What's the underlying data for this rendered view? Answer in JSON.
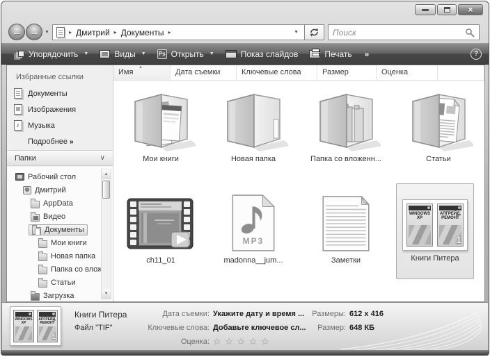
{
  "glyphs": {
    "back": "←",
    "forward": "→",
    "dropdown": "▼",
    "nav_history": "▼",
    "breadcrumb_sep": "▸",
    "overflow": "»",
    "help": "?",
    "close": "×",
    "sort_asc": "▲",
    "panel_collapse": "∨",
    "scroll_up": "▲",
    "scroll_down": "▼",
    "more_arrows": "»",
    "music_note": "♪"
  },
  "address": {
    "breadcrumb": [
      "Дмитрий",
      "Документы"
    ],
    "search_placeholder": "Поиск"
  },
  "toolbar": {
    "items": [
      {
        "label": "Упорядочить"
      },
      {
        "label": "Виды"
      },
      {
        "label": "Открыть",
        "badge": "Ps"
      },
      {
        "label": "Показ слайдов"
      },
      {
        "label": "Печать"
      }
    ]
  },
  "sidebar": {
    "favorites_title": "Избранные ссылки",
    "favorites": [
      {
        "label": "Документы"
      },
      {
        "label": "Изображения"
      },
      {
        "label": "Музыка"
      }
    ],
    "more_label": "Подробнее",
    "folders_title": "Папки",
    "tree": [
      {
        "label": "Рабочий стол"
      },
      {
        "label": "Дмитрий"
      },
      {
        "label": "AppData"
      },
      {
        "label": "Видео"
      },
      {
        "label": "Документы"
      },
      {
        "label": "Мои книги"
      },
      {
        "label": "Новая папка"
      },
      {
        "label": "Папка со вложе"
      },
      {
        "label": "Статьи"
      },
      {
        "label": "Загрузка"
      }
    ]
  },
  "main": {
    "columns": [
      {
        "label": "Имя"
      },
      {
        "label": "Дата съемки"
      },
      {
        "label": "Ключевые слова"
      },
      {
        "label": "Размер"
      },
      {
        "label": "Оценка"
      }
    ],
    "files": [
      {
        "label": "Мои книги"
      },
      {
        "label": "Новая папка"
      },
      {
        "label": "Папка со вложенн..."
      },
      {
        "label": "Статьи"
      },
      {
        "label": "ch11_01"
      },
      {
        "label": "madonna__jum...",
        "badge": "MP3"
      },
      {
        "label": "Заметки"
      },
      {
        "label": "Книги Питера"
      }
    ]
  },
  "book_covers": {
    "left_title": "WINDOWS XP",
    "right_title": "АПГРЕЙД, РЕМОНТ",
    "right_numeral": "1"
  },
  "details": {
    "name": "Книги Питера",
    "type": "Файл \"TIF\"",
    "date_label": "Дата съемки:",
    "date_value": "Укажите дату и время ...",
    "keywords_label": "Ключевые слова:",
    "keywords_value": "Добавьте ключевое сл...",
    "rating_label": "Оценка:",
    "rating_stars": "☆ ☆ ☆ ☆ ☆",
    "dims_label": "Размеры:",
    "dims_value": "612 x 416",
    "size_label": "Размер:",
    "size_value": "648 КБ"
  }
}
